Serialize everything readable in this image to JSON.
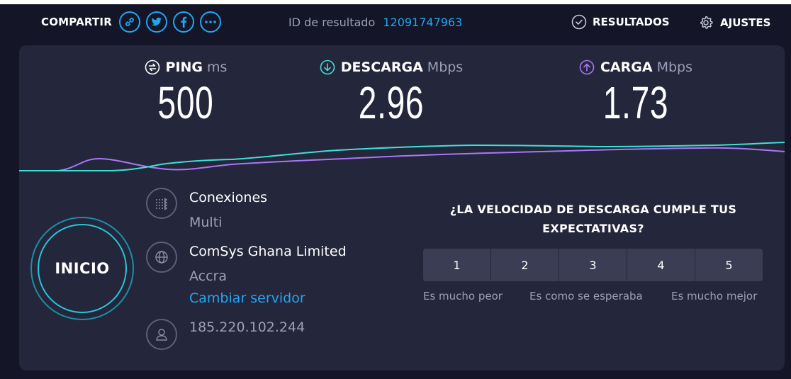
{
  "share": {
    "label": "COMPARTIR",
    "icons": [
      "link-icon",
      "twitter-icon",
      "facebook-icon",
      "more-icon"
    ]
  },
  "result": {
    "label": "ID de resultado",
    "id": "12091747963"
  },
  "nav": {
    "results": "RESULTADOS",
    "settings": "AJUSTES"
  },
  "metrics": {
    "ping": {
      "name": "PING",
      "unit": "ms",
      "value": "500"
    },
    "download": {
      "name": "DESCARGA",
      "unit": "Mbps",
      "value": "2.96"
    },
    "upload": {
      "name": "CARGA",
      "unit": "Mbps",
      "value": "1.73"
    }
  },
  "start": {
    "label": "INICIO"
  },
  "connections": {
    "title": "Conexiones",
    "value": "Multi"
  },
  "server": {
    "name": "ComSys Ghana Limited",
    "city": "Accra",
    "change": "Cambiar servidor"
  },
  "client": {
    "ip": "185.220.102.244"
  },
  "survey": {
    "question": "¿LA VELOCIDAD DE DESCARGA CUMPLE TUS EXPECTATIVAS?",
    "options": [
      "1",
      "2",
      "3",
      "4",
      "5"
    ],
    "low": "Es mucho peor",
    "mid": "Es como se esperaba",
    "high": "Es mucho mejor"
  },
  "colors": {
    "background": "#141526",
    "card": "#24263b",
    "accent": "#1fa7f2",
    "download": "#3ee0d5",
    "upload": "#a877f5"
  }
}
